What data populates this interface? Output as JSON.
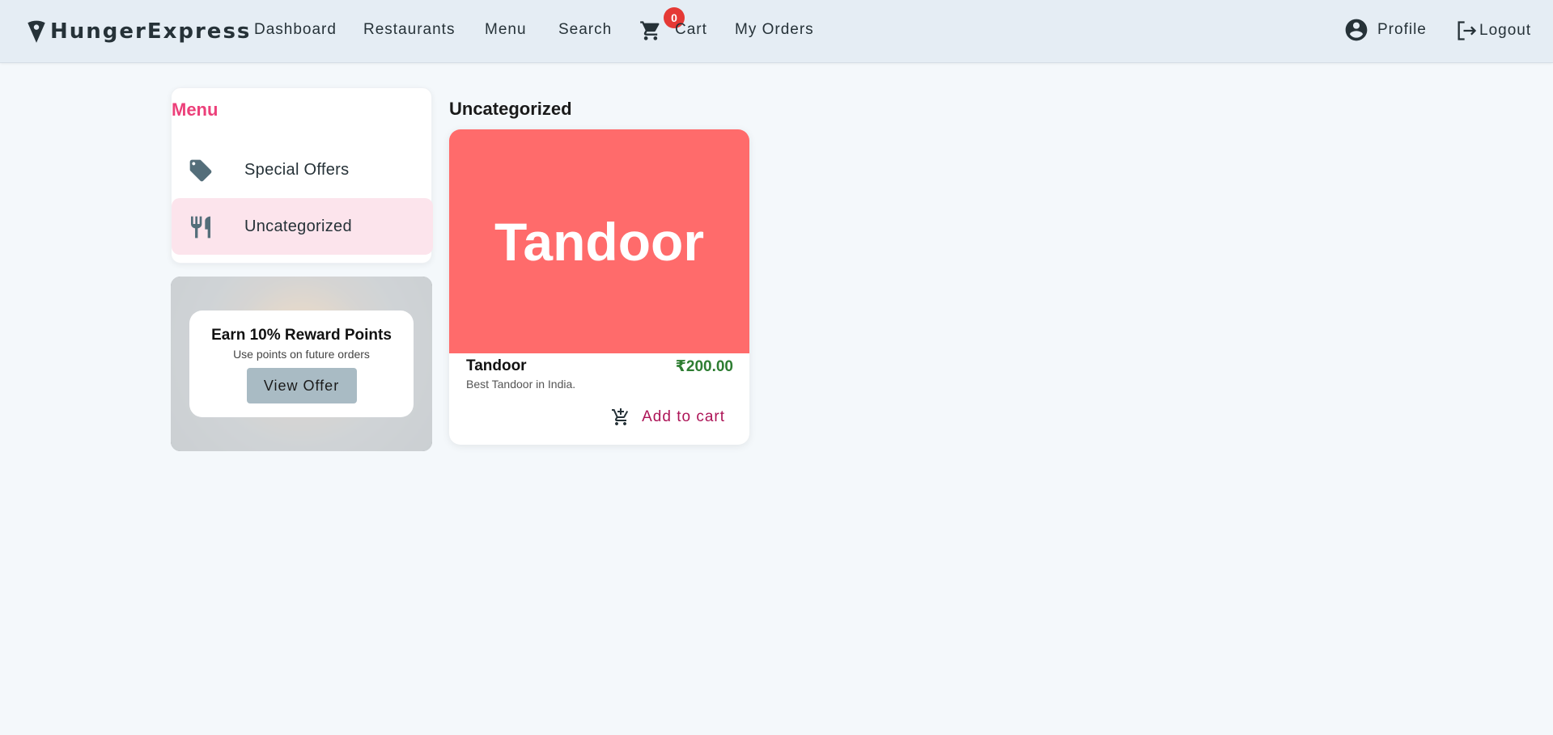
{
  "header": {
    "brand": "HungerExpress",
    "nav": [
      "Dashboard",
      "Restaurants",
      "Menu",
      "Search"
    ],
    "cart_label": "Cart",
    "cart_count": "0",
    "orders_label": "My Orders",
    "profile_label": "Profile",
    "logout_label": "Logout"
  },
  "sidebar": {
    "title": "Menu",
    "items": [
      {
        "label": "Special Offers",
        "icon": "tag-icon"
      },
      {
        "label": "Uncategorized",
        "icon": "fork-knife-icon",
        "active": true
      }
    ]
  },
  "promo": {
    "title": "Earn 10% Reward Points",
    "subtitle": "Use points on future orders",
    "button": "View Offer"
  },
  "section": {
    "title": "Uncategorized",
    "products": [
      {
        "image_text": "Tandoor",
        "name": "Tandoor",
        "price": "₹200.00",
        "description": "Best Tandoor in India.",
        "action": "Add to cart"
      }
    ]
  },
  "colors": {
    "accent_pink": "#ec407a",
    "active_bg": "#fce4ec",
    "product_bg": "#ff6b6b",
    "price_green": "#2e7d32",
    "badge_red": "#e53935"
  }
}
